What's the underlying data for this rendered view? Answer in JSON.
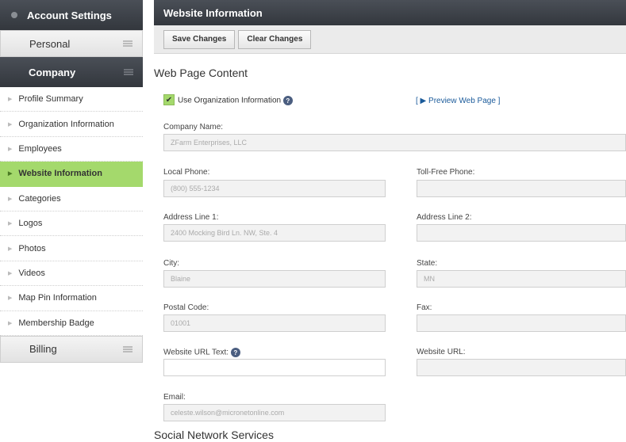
{
  "sidebar": {
    "account_header": "Account Settings",
    "personal": "Personal",
    "company": "Company",
    "billing": "Billing",
    "items": [
      {
        "label": "Profile Summary"
      },
      {
        "label": "Organization Information"
      },
      {
        "label": "Employees"
      },
      {
        "label": "Website Information"
      },
      {
        "label": "Categories"
      },
      {
        "label": "Logos"
      },
      {
        "label": "Photos"
      },
      {
        "label": "Videos"
      },
      {
        "label": "Map Pin Information"
      },
      {
        "label": "Membership Badge"
      }
    ],
    "active_index": 3
  },
  "main": {
    "header": "Website Information",
    "save_label": "Save Changes",
    "clear_label": "Clear Changes",
    "page_title": "Web Page Content",
    "use_org_label": "Use Organization Information",
    "use_org_checked": true,
    "preview_link": "[ ▶ Preview Web Page ]",
    "company_name_label": "Company Name:",
    "company_name_value": "ZFarm Enterprises, LLC",
    "local_phone_label": "Local Phone:",
    "local_phone_value": "(800) 555-1234",
    "toll_free_label": "Toll-Free Phone:",
    "toll_free_value": "",
    "address1_label": "Address Line 1:",
    "address1_value": "2400 Mocking Bird Ln. NW, Ste. 4",
    "address2_label": "Address Line 2:",
    "address2_value": "",
    "city_label": "City:",
    "city_value": "Blaine",
    "state_label": "State:",
    "state_value": "MN",
    "postal_label": "Postal Code:",
    "postal_value": "01001",
    "fax_label": "Fax:",
    "fax_value": "",
    "url_text_label": "Website URL Text:",
    "url_text_value": "",
    "url_label": "Website URL:",
    "url_value": "",
    "email_label": "Email:",
    "email_value": "celeste.wilson@micronetonline.com",
    "social_title": "Social Network Services"
  }
}
